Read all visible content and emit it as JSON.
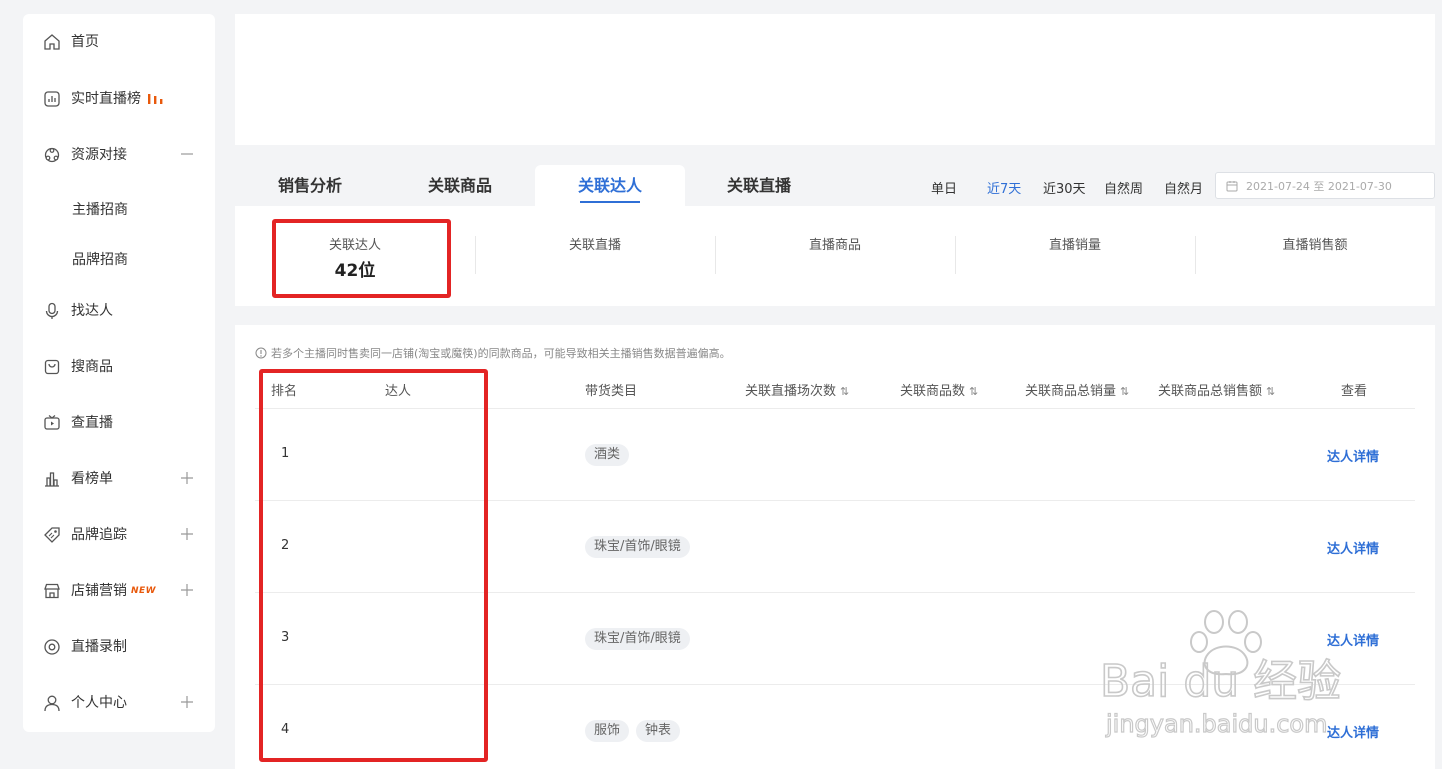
{
  "sidebar": {
    "items": [
      {
        "label": "首页",
        "icon": "home-icon"
      },
      {
        "label": "实时直播榜",
        "icon": "live-chart-icon"
      },
      {
        "label": "资源对接",
        "icon": "resource-icon",
        "expand": "minus"
      },
      {
        "label": "主播招商"
      },
      {
        "label": "品牌招商"
      },
      {
        "label": "找达人",
        "icon": "microphone-icon"
      },
      {
        "label": "搜商品",
        "icon": "bag-icon"
      },
      {
        "label": "查直播",
        "icon": "tv-icon"
      },
      {
        "label": "看榜单",
        "icon": "bar-chart-icon",
        "expand": "plus"
      },
      {
        "label": "品牌追踪",
        "icon": "tag-icon",
        "expand": "plus"
      },
      {
        "label": "店铺营销",
        "icon": "store-icon",
        "badge": "NEW",
        "expand": "plus"
      },
      {
        "label": "直播录制",
        "icon": "record-icon"
      },
      {
        "label": "个人中心",
        "icon": "user-icon",
        "expand": "plus"
      }
    ]
  },
  "tabs": [
    {
      "label": "销售分析"
    },
    {
      "label": "关联商品"
    },
    {
      "label": "关联达人"
    },
    {
      "label": "关联直播"
    }
  ],
  "ranges": [
    {
      "label": "单日"
    },
    {
      "label": "近7天"
    },
    {
      "label": "近30天"
    },
    {
      "label": "自然周"
    },
    {
      "label": "自然月"
    }
  ],
  "date_range": "2021-07-24 至 2021-07-30",
  "stats": [
    {
      "title": "关联达人",
      "value": "42位"
    },
    {
      "title": "关联直播",
      "value": ""
    },
    {
      "title": "直播商品",
      "value": ""
    },
    {
      "title": "直播销量",
      "value": ""
    },
    {
      "title": "直播销售额",
      "value": ""
    }
  ],
  "notice": "若多个主播同时售卖同一店铺(淘宝或魔筷)的同款商品，可能导致相关主播销售数据普遍偏高。",
  "table": {
    "headers": {
      "rank": "排名",
      "influencer": "达人",
      "category": "带货类目",
      "sessions": "关联直播场次数",
      "goods": "关联商品数",
      "sales_volume": "关联商品总销量",
      "sales_amount": "关联商品总销售额",
      "view": "查看"
    },
    "sort_glyph": "⇅",
    "detail_label": "达人详情",
    "rows": [
      {
        "rank": "1",
        "tags": [
          "酒类"
        ]
      },
      {
        "rank": "2",
        "tags": [
          "珠宝/首饰/眼镜"
        ]
      },
      {
        "rank": "3",
        "tags": [
          "珠宝/首饰/眼镜"
        ]
      },
      {
        "rank": "4",
        "tags": [
          "服饰",
          "钟表"
        ]
      }
    ]
  },
  "colors": {
    "accent": "#2f6fd6",
    "highlight": "#e32424",
    "new_badge": "#e8590c"
  },
  "watermark": {
    "brand": "Bai du 经验",
    "url": "jingyan.baidu.com"
  }
}
